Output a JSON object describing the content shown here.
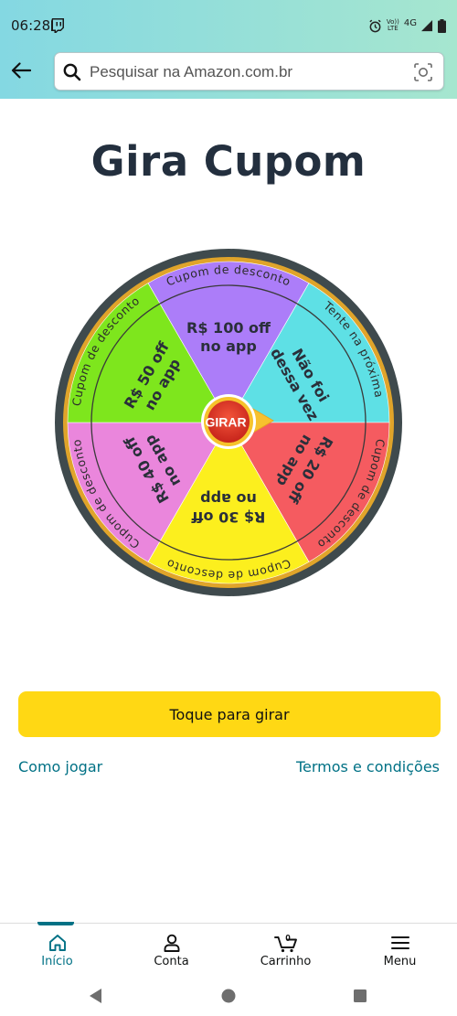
{
  "status": {
    "time": "06:28",
    "network_label_top": "Vo))",
    "network_label_bottom": "LTE",
    "network_type": "4G",
    "icons": [
      "twitch-icon",
      "alarm-icon",
      "signal-icon",
      "battery-icon"
    ]
  },
  "header": {
    "back_icon": "arrow-left-icon",
    "search_placeholder": "Pesquisar na Amazon.com.br",
    "camera_icon": "camera-lens-icon"
  },
  "page": {
    "title": "Gira Cupom"
  },
  "wheel": {
    "center_label": "GIRAR",
    "segments": [
      {
        "color": "#ac7df9",
        "line1": "R$ 100 off",
        "line2": "no app",
        "outer": "Cupom de desconto"
      },
      {
        "color": "#5ee0e5",
        "line1": "Não foi",
        "line2": "dessa vez",
        "outer": "Tente na próxima"
      },
      {
        "color": "#f55b60",
        "line1": "R$ 20 off",
        "line2": "no app",
        "outer": "Cupom de desconto"
      },
      {
        "color": "#fcef1e",
        "line1": "R$ 30 off",
        "line2": "no app",
        "outer": "Cupom de desconto"
      },
      {
        "color": "#ea86dc",
        "line1": "R$ 40 off",
        "line2": "no app",
        "outer": "Cupom de desconto"
      },
      {
        "color": "#7ee61d",
        "line1": "R$ 50 off",
        "line2": "no app",
        "outer": "Cupom de desconto"
      }
    ]
  },
  "actions": {
    "spin_label": "Toque para girar",
    "how_to_play": "Como jogar",
    "terms": "Termos e condições"
  },
  "bottom_nav": [
    {
      "label": "Início",
      "icon": "home-icon",
      "active": true
    },
    {
      "label": "Conta",
      "icon": "person-icon",
      "active": false
    },
    {
      "label": "Carrinho",
      "icon": "cart-icon",
      "active": false,
      "badge": "0"
    },
    {
      "label": "Menu",
      "icon": "hamburger-menu-icon",
      "active": false
    }
  ],
  "colors": {
    "accent": "#007185",
    "button": "#ffd814",
    "title": "#232f3e"
  }
}
